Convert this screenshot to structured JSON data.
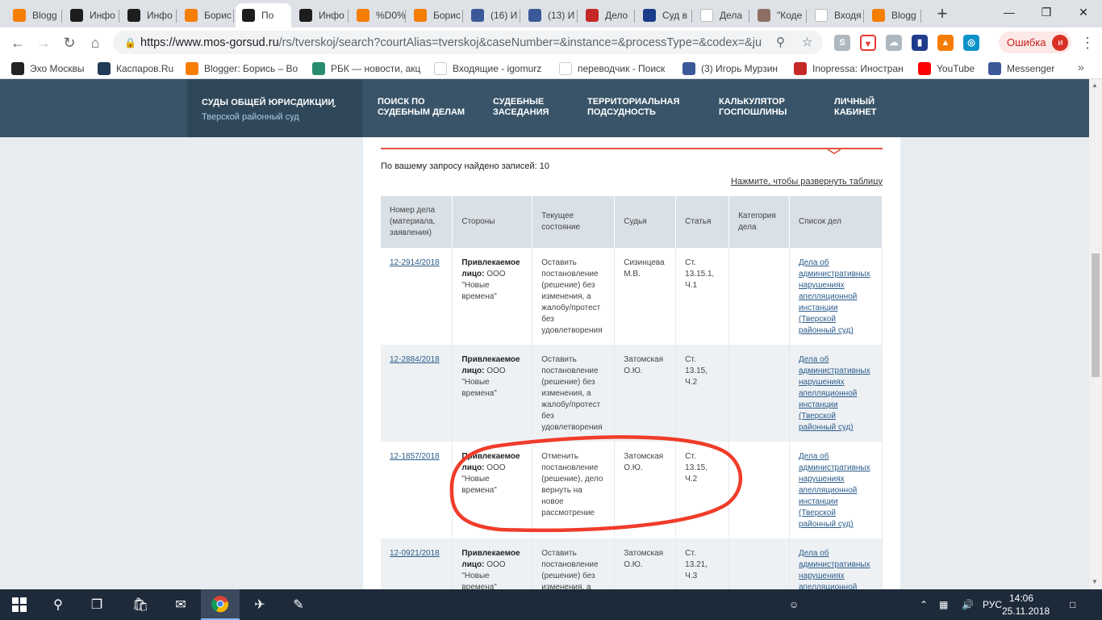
{
  "browser": {
    "tabs": [
      {
        "title": "Blogg",
        "icon": "blogger-icon",
        "color": "#f57d00"
      },
      {
        "title": "Инфо",
        "icon": "court-icon",
        "color": "#1d1d1d"
      },
      {
        "title": "Инфо",
        "icon": "court-icon",
        "color": "#1d1d1d"
      },
      {
        "title": "Борис",
        "icon": "blogger-icon",
        "color": "#f57d00"
      },
      {
        "title": "По",
        "icon": "court-icon",
        "color": "#1d1d1d",
        "active": true
      },
      {
        "title": "Инфо",
        "icon": "court-icon",
        "color": "#1d1d1d"
      },
      {
        "title": "%D0%",
        "icon": "blogger-icon",
        "color": "#f57d00"
      },
      {
        "title": "Борис",
        "icon": "blogger-icon",
        "color": "#f57d00"
      },
      {
        "title": "(16) И",
        "icon": "facebook-icon",
        "color": "#3b5998"
      },
      {
        "title": "(13) И",
        "icon": "facebook-icon",
        "color": "#3b5998"
      },
      {
        "title": "Дело",
        "icon": "case-icon",
        "color": "#c62828"
      },
      {
        "title": "Суд в",
        "icon": "globe-icon",
        "color": "#1a3c8b"
      },
      {
        "title": "Дела",
        "icon": "document-icon",
        "color": "#ffffff"
      },
      {
        "title": "\"Коде",
        "icon": "avatar-icon",
        "color": "#8d6e63"
      },
      {
        "title": "Входя",
        "icon": "gmail-icon",
        "color": "#ffffff"
      },
      {
        "title": "Blogg",
        "icon": "blogger-icon",
        "color": "#f57d00"
      }
    ],
    "new_tab": "+",
    "window_controls": [
      "—",
      "❐",
      "✕"
    ],
    "url_host": "https://www.mos-gorsud.ru",
    "url_path": "/rs/tverskoj/search?courtAlias=tverskoj&caseNumber=&instance=&processType=&codex=&ju...",
    "error_label": "Ошибка",
    "profile_initial": "и",
    "bookmarks": [
      {
        "label": "Эхо Москвы",
        "icon": "echo-icon",
        "color": "#222222"
      },
      {
        "label": "Каспаров.Ru",
        "icon": "kasparov-icon",
        "color": "#1f3b57"
      },
      {
        "label": "Blogger: Борись – Во",
        "icon": "blogger-icon",
        "color": "#f57d00"
      },
      {
        "label": "РБК — новости, акц",
        "icon": "rbc-icon",
        "color": "#2a8c6e"
      },
      {
        "label": "Входящие - igomurz",
        "icon": "gmail-icon",
        "color": "#ffffff"
      },
      {
        "label": "переводчик - Поиск",
        "icon": "google-icon",
        "color": "#ffffff"
      },
      {
        "label": "(3) Игорь Мурзин",
        "icon": "facebook-icon",
        "color": "#3b5998"
      },
      {
        "label": "Inopressa: Иностран",
        "icon": "inopressa-icon",
        "color": "#c62828"
      },
      {
        "label": "YouTube",
        "icon": "youtube-icon",
        "color": "#ff0000"
      },
      {
        "label": "Messenger",
        "icon": "facebook-icon",
        "color": "#3b5998"
      }
    ],
    "bookmarks_more": "»"
  },
  "site": {
    "nav_first_title": "СУДЫ ОБЩЕЙ ЮРИСДИКЦИИ",
    "nav_first_sub": "Тверской районный суд",
    "nav_items": [
      {
        "line1": "ПОИСК ПО",
        "line2": "СУДЕБНЫМ ДЕЛАМ"
      },
      {
        "line1": "СУДЕБНЫЕ",
        "line2": "ЗАСЕДАНИЯ"
      },
      {
        "line1": "ТЕРРИТОРИАЛЬНАЯ",
        "line2": "ПОДСУДНОСТЬ"
      },
      {
        "line1": "КАЛЬКУЛЯТОР",
        "line2": "ГОСПОШЛИНЫ"
      },
      {
        "line1": "ЛИЧНЫЙ",
        "line2": "КАБИНЕТ"
      }
    ],
    "found_text": "По вашему запросу найдено записей: 10",
    "expand_link": "Нажмите, чтобы развернуть таблицу",
    "accent_color": "#e4533e",
    "nav_color": "#395468"
  },
  "table": {
    "headers": [
      "Номер дела (материала, заявления)",
      "Стороны",
      "Текущее состояние",
      "Судья",
      "Статья",
      "Категория дела",
      "Список дел"
    ],
    "rows": [
      {
        "number": "12-2914/2018",
        "party_label": "Привлекаемое лицо:",
        "party": "ООО \"Новые времена\"",
        "status": "Оставить постановление (решение) без изменения, а жалобу/протест без удовлетворения",
        "judge": "Сизинцева М.В.",
        "article": "Ст. 13.15.1, Ч.1",
        "category": "",
        "list": "Дела об административных нарушениях апелляционной инстанции (Тверской районный суд)"
      },
      {
        "number": "12-2884/2018",
        "party_label": "Привлекаемое лицо:",
        "party": "ООО \"Новые времена\"",
        "status": "Оставить постановление (решение) без изменения, а жалобу/протест без удовлетворения",
        "judge": "Затомская О.Ю.",
        "article": "Ст. 13.15, Ч.2",
        "category": "",
        "list": "Дела об административных нарушениях апелляционной инстанции (Тверской районный суд)"
      },
      {
        "number": "12-1857/2018",
        "party_label": "Привлекаемое лицо:",
        "party": "ООО \"Новые времена\"",
        "status": "Отменить постановление (решение), дело вернуть на новое рассмотрение",
        "judge": "Затомская О.Ю.",
        "article": "Ст. 13.15, Ч.2",
        "category": "",
        "list": "Дела об административных нарушениях апелляционной инстанции (Тверской районный суд)"
      },
      {
        "number": "12-0921/2018",
        "party_label": "Привлекаемое лицо:",
        "party": "ООО \"Новые времена\"",
        "status": "Оставить постановление (решение) без изменения, а жалобу/протест без удовлетворения",
        "judge": "Затомская О.Ю.",
        "article": "Ст. 13.21, Ч.3",
        "category": "",
        "list": "Дела об административных нарушениях апелляционной инстанции (Тверской районный суд)"
      }
    ]
  },
  "annotation": {
    "color": "#f03c2a"
  },
  "taskbar": {
    "icons": [
      "windows-start-icon",
      "search-icon",
      "task-view-icon",
      "store-icon",
      "mail-icon",
      "chrome-icon",
      "airplane-app-icon",
      "paint-icon"
    ],
    "language": "РУС",
    "time": "14:06",
    "date": "25.11.2018"
  }
}
